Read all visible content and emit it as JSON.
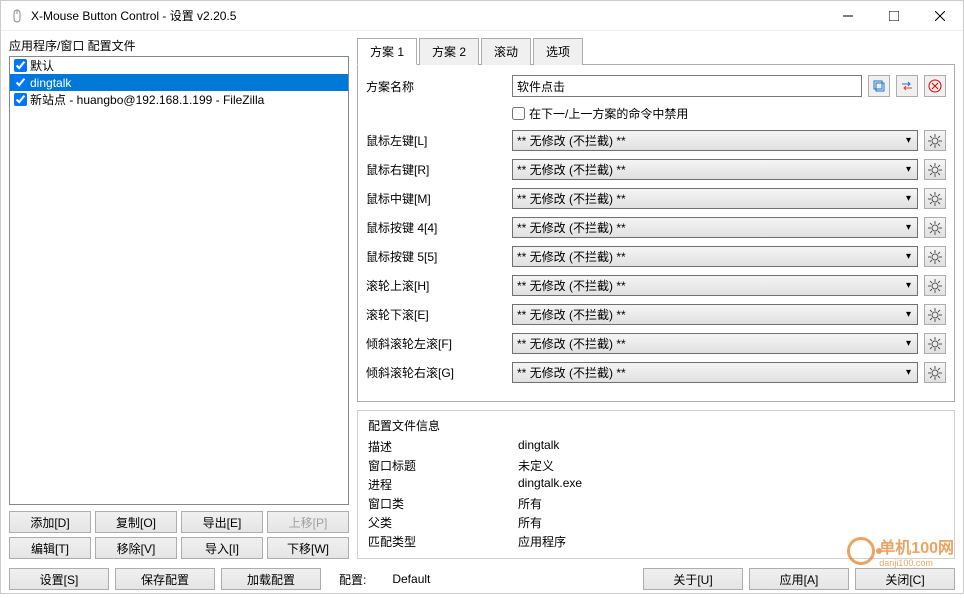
{
  "titlebar": {
    "text": "X-Mouse Button Control - 设置 v2.20.5"
  },
  "left": {
    "group_label": "应用程序/窗口 配置文件",
    "items": [
      {
        "label": "默认",
        "checked": true,
        "selected": false
      },
      {
        "label": "dingtalk",
        "checked": true,
        "selected": true
      },
      {
        "label": "新站点 - huangbo@192.168.1.199 - FileZilla",
        "checked": true,
        "selected": false
      }
    ],
    "buttons": {
      "add": "添加[D]",
      "copy": "复制[O]",
      "export": "导出[E]",
      "up": "上移[P]",
      "edit": "编辑[T]",
      "remove": "移除[V]",
      "import": "导入[I]",
      "down": "下移[W]"
    }
  },
  "tabs": {
    "t1": "方案 1",
    "t2": "方案 2",
    "t3": "滚动",
    "t4": "选项"
  },
  "plan": {
    "name_label": "方案名称",
    "name_value": "软件点击",
    "disable_label": "在下一/上一方案的命令中禁用",
    "rows": [
      {
        "label": "鼠标左键[L]",
        "value": "** 无修改 (不拦截) **"
      },
      {
        "label": "鼠标右键[R]",
        "value": "** 无修改 (不拦截) **"
      },
      {
        "label": "鼠标中键[M]",
        "value": "** 无修改 (不拦截) **"
      },
      {
        "label": "鼠标按键 4[4]",
        "value": "** 无修改 (不拦截) **"
      },
      {
        "label": "鼠标按键 5[5]",
        "value": "** 无修改 (不拦截) **"
      },
      {
        "label": "滚轮上滚[H]",
        "value": "** 无修改 (不拦截) **"
      },
      {
        "label": "滚轮下滚[E]",
        "value": "** 无修改 (不拦截) **"
      },
      {
        "label": "倾斜滚轮左滚[F]",
        "value": "** 无修改 (不拦截) **"
      },
      {
        "label": "倾斜滚轮右滚[G]",
        "value": "** 无修改 (不拦截) **"
      }
    ]
  },
  "info": {
    "title": "配置文件信息",
    "desc_label": "描述",
    "desc_value": "dingtalk",
    "wintitle_label": "窗口标题",
    "wintitle_value": "未定义",
    "process_label": "进程",
    "process_value": "dingtalk.exe",
    "class_label": "窗口类",
    "class_value": "所有",
    "parent_label": "父类",
    "parent_value": "所有",
    "match_label": "匹配类型",
    "match_value": "应用程序"
  },
  "bottom": {
    "settings": "设置[S]",
    "save": "保存配置",
    "load": "加载配置",
    "profile_label": "配置:",
    "profile_value": "Default",
    "about": "关于[U]",
    "apply": "应用[A]",
    "close": "关闭[C]"
  },
  "watermark": {
    "text": "单机100网",
    "sub": "danji100.com"
  }
}
